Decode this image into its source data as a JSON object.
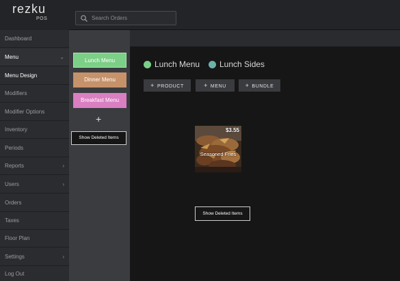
{
  "brand": {
    "name": "rezku",
    "sub": "POS"
  },
  "search": {
    "placeholder": "Search Orders",
    "value": ""
  },
  "sidebar": {
    "items": [
      {
        "label": "Dashboard",
        "chevron": ""
      },
      {
        "label": "Menu",
        "chevron": "⌄"
      },
      {
        "label": "Menu Design",
        "chevron": ""
      },
      {
        "label": "Modifiers",
        "chevron": ""
      },
      {
        "label": "Modifier Options",
        "chevron": ""
      },
      {
        "label": "Inventory",
        "chevron": ""
      },
      {
        "label": "Periods",
        "chevron": ""
      },
      {
        "label": "Reports",
        "chevron": "›"
      },
      {
        "label": "Users",
        "chevron": "›"
      },
      {
        "label": "Orders",
        "chevron": ""
      },
      {
        "label": "Taxes",
        "chevron": ""
      },
      {
        "label": "Floor Plan",
        "chevron": ""
      },
      {
        "label": "Settings",
        "chevron": "›"
      },
      {
        "label": "Log Out",
        "chevron": ""
      }
    ]
  },
  "menus": {
    "items": [
      {
        "label": "Lunch Menu",
        "color": "#7ccf86"
      },
      {
        "label": "Dinner Menu",
        "color": "#c6926a"
      },
      {
        "label": "Breakfast Menu",
        "color": "#d97fc2"
      }
    ],
    "add_label": "+",
    "show_deleted": "Show Deleted Items"
  },
  "main": {
    "tabs": [
      {
        "label": "Lunch Menu",
        "color": "#7ccf86"
      },
      {
        "label": "Lunch Sides",
        "color": "#6bb2a8"
      }
    ],
    "actions": [
      {
        "icon": "+",
        "label": "PRODUCT"
      },
      {
        "icon": "+",
        "label": "MENU"
      },
      {
        "icon": "+",
        "label": "BUNDLE"
      }
    ],
    "products": [
      {
        "name": "Seasoned Fries",
        "price": "$3.55"
      }
    ],
    "show_deleted": "Show Deleted Items"
  }
}
